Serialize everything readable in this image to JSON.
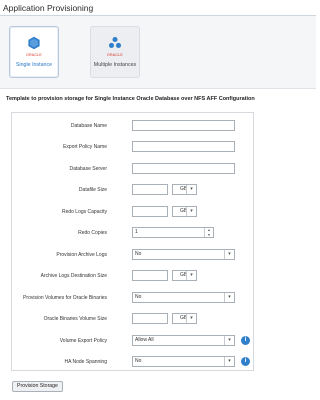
{
  "header": {
    "title": "Application Provisioning"
  },
  "cards": [
    {
      "brand": "ORACLE",
      "label": "Single Instance",
      "selected": true
    },
    {
      "brand": "ORACLE",
      "label": "Multiple Instances",
      "selected": false
    }
  ],
  "description": "Template to provision storage for Single Instance Oracle Database over NFS AFF Configuration",
  "form": {
    "database_name": {
      "label": "Database Name",
      "value": ""
    },
    "export_policy_name": {
      "label": "Export Policy Name",
      "value": ""
    },
    "database_server": {
      "label": "Database Server",
      "value": ""
    },
    "datafile_size": {
      "label": "Datafile Size",
      "value": "",
      "unit": "GB"
    },
    "redo_logs_capacity": {
      "label": "Redo Logs Capacity",
      "value": "",
      "unit": "GB"
    },
    "redo_copies": {
      "label": "Redo Copies",
      "value": "1"
    },
    "provision_archive_logs": {
      "label": "Provision Archive Logs",
      "value": "No"
    },
    "archive_logs_destination_size": {
      "label": "Archive Logs Destination Size",
      "value": "",
      "unit": "GB"
    },
    "provision_volumes_binaries": {
      "label": "Provision Volumes for Oracle Binaries",
      "value": "No"
    },
    "oracle_binaries_volume_size": {
      "label": "Oracle Binaries Volume Size",
      "value": "",
      "unit": "GB"
    },
    "volume_export_policy": {
      "label": "Volume Export Policy",
      "value": "Allow All"
    },
    "ha_node_spanning": {
      "label": "HA Node Spanning",
      "value": "No"
    }
  },
  "actions": {
    "submit_label": "Provision Storage"
  },
  "colors": {
    "accent": "#2a78c9",
    "oracle_red": "#d9261c",
    "info": "#2f7fcb"
  }
}
